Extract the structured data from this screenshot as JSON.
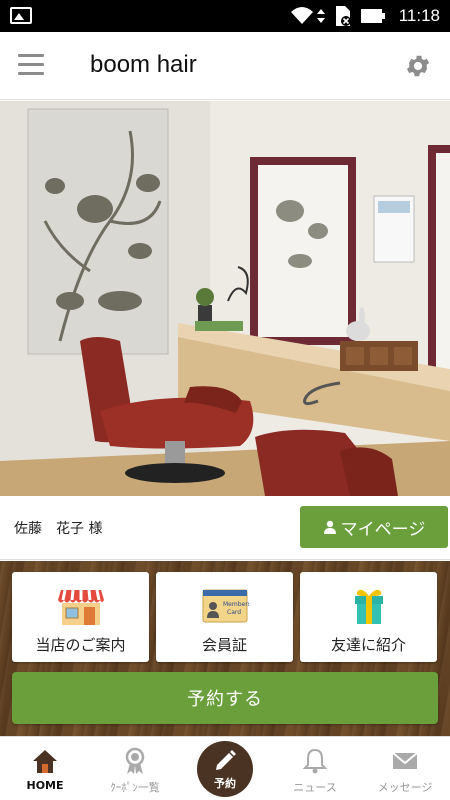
{
  "status_bar": {
    "time": "11:18",
    "icons": [
      "image-notification-icon",
      "wifi-icon",
      "sim-card-icon",
      "battery-icon"
    ]
  },
  "app_bar": {
    "title": "boom hair",
    "menu_icon": "hamburger-menu-icon",
    "settings_icon": "gear-icon"
  },
  "hero": {
    "image": "salon-interior-photo"
  },
  "user": {
    "name": "佐藤　花子 様",
    "mypage_label": "マイページ",
    "mypage_icon": "person-icon"
  },
  "tiles": [
    {
      "label": "当店のご案内",
      "icon": "shop-icon"
    },
    {
      "label": "会員証",
      "icon": "members-card-icon"
    },
    {
      "label": "友達に紹介",
      "icon": "gift-icon"
    }
  ],
  "reserve_button": {
    "label": "予約する"
  },
  "bottom_nav": {
    "items": [
      {
        "label": "HOME",
        "icon": "home-icon",
        "active": true
      },
      {
        "label": "ｸｰﾎﾟﾝ一覧",
        "icon": "ribbon-icon",
        "active": false
      },
      {
        "label": "予約",
        "icon": "pencil-icon",
        "active": false
      },
      {
        "label": "ニュース",
        "icon": "bell-icon",
        "active": false
      },
      {
        "label": "メッセージ",
        "icon": "envelope-icon",
        "active": false
      }
    ]
  },
  "colors": {
    "accent_green": "#6a9f3c",
    "nav_center_brown": "#4a3322",
    "wood_brown": "#6b4a28"
  }
}
